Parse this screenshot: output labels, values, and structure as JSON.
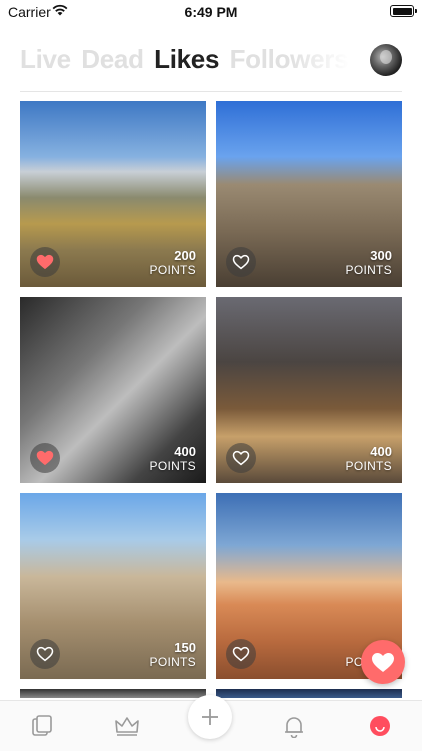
{
  "status_bar": {
    "carrier": "Carrier",
    "time": "6:49 PM"
  },
  "tabs": [
    {
      "label": "Live",
      "active": false
    },
    {
      "label": "Dead",
      "active": false
    },
    {
      "label": "Likes",
      "active": true
    },
    {
      "label": "Followers",
      "active": false
    }
  ],
  "cards": [
    {
      "points": "200",
      "unit": "POINTS",
      "liked": true,
      "scene": "mountain"
    },
    {
      "points": "300",
      "unit": "POINTS",
      "liked": false,
      "scene": "castle"
    },
    {
      "points": "400",
      "unit": "POINTS",
      "liked": true,
      "scene": "alley"
    },
    {
      "points": "400",
      "unit": "POINTS",
      "liked": false,
      "scene": "fountain"
    },
    {
      "points": "150",
      "unit": "POINTS",
      "liked": false,
      "scene": "tower"
    },
    {
      "points": "",
      "unit": "POINTS",
      "liked": false,
      "scene": "beach"
    }
  ],
  "colors": {
    "accent": "#ff6b6b",
    "tab_inactive": "#e0e0e0",
    "tab_active": "#222222"
  },
  "tabbar_icons": [
    "cards-icon",
    "crown-icon",
    "plus-icon",
    "bell-icon",
    "smile-icon"
  ]
}
